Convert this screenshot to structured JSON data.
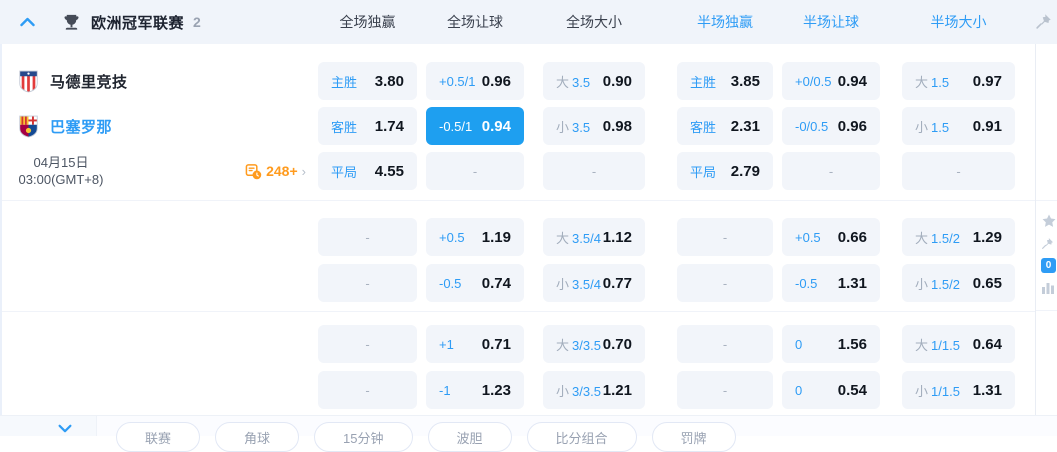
{
  "header": {
    "league": "欧洲冠军联赛",
    "count": "2",
    "columns": [
      "全场独赢",
      "全场让球",
      "全场大小",
      "半场独赢",
      "半场让球",
      "半场大小"
    ]
  },
  "match": {
    "home_team": "马德里竞技",
    "away_team": "巴塞罗那",
    "date": "04月15日",
    "time": "03:00(GMT+8)",
    "more_markets": "248+"
  },
  "odds": {
    "dash": "-",
    "groups": [
      {
        "rows": [
          {
            "cells": [
              {
                "label": "主胜",
                "value": "3.80"
              },
              {
                "label": "+0.5/1",
                "value": "0.96"
              },
              {
                "prefix": "大",
                "line": "3.5",
                "value": "0.90"
              },
              {
                "label": "主胜",
                "value": "3.85"
              },
              {
                "label": "+0/0.5",
                "value": "0.94"
              },
              {
                "prefix": "大",
                "line": "1.5",
                "value": "0.97"
              }
            ]
          },
          {
            "cells": [
              {
                "label": "客胜",
                "value": "1.74"
              },
              {
                "label": "-0.5/1",
                "value": "0.94",
                "selected": true
              },
              {
                "prefix": "小",
                "line": "3.5",
                "value": "0.98"
              },
              {
                "label": "客胜",
                "value": "2.31"
              },
              {
                "label": "-0/0.5",
                "value": "0.96"
              },
              {
                "prefix": "小",
                "line": "1.5",
                "value": "0.91"
              }
            ]
          },
          {
            "cells": [
              {
                "label": "平局",
                "value": "4.55"
              },
              {
                "dash": true
              },
              {
                "dash": true
              },
              {
                "label": "平局",
                "value": "2.79"
              },
              {
                "dash": true
              },
              {
                "dash": true
              }
            ]
          }
        ]
      },
      {
        "rows": [
          {
            "cells": [
              {
                "dash": true
              },
              {
                "label": "+0.5",
                "value": "1.19"
              },
              {
                "prefix": "大",
                "line": "3.5/4",
                "value": "1.12"
              },
              {
                "dash": true
              },
              {
                "label": "+0.5",
                "value": "0.66"
              },
              {
                "prefix": "大",
                "line": "1.5/2",
                "value": "1.29"
              }
            ]
          },
          {
            "cells": [
              {
                "dash": true
              },
              {
                "label": "-0.5",
                "value": "0.74"
              },
              {
                "prefix": "小",
                "line": "3.5/4",
                "value": "0.77"
              },
              {
                "dash": true
              },
              {
                "label": "-0.5",
                "value": "1.31"
              },
              {
                "prefix": "小",
                "line": "1.5/2",
                "value": "0.65"
              }
            ]
          }
        ]
      },
      {
        "rows": [
          {
            "cells": [
              {
                "dash": true
              },
              {
                "label": "+1",
                "value": "0.71"
              },
              {
                "prefix": "大",
                "line": "3/3.5",
                "value": "0.70"
              },
              {
                "dash": true
              },
              {
                "label": "0",
                "value": "1.56"
              },
              {
                "prefix": "大",
                "line": "1/1.5",
                "value": "0.64"
              }
            ]
          },
          {
            "cells": [
              {
                "dash": true
              },
              {
                "label": "-1",
                "value": "1.23"
              },
              {
                "prefix": "小",
                "line": "3/3.5",
                "value": "1.21"
              },
              {
                "dash": true
              },
              {
                "label": "0",
                "value": "0.54"
              },
              {
                "prefix": "小",
                "line": "1/1.5",
                "value": "1.31"
              }
            ]
          }
        ]
      }
    ]
  },
  "side": {
    "badge": "0"
  },
  "footer": {
    "pills": [
      "联赛",
      "角球",
      "15分钟",
      "波胆",
      "比分组合",
      "罚牌"
    ]
  },
  "colors": {
    "accent_blue": "#2e9cf5",
    "selected_blue": "#1e9ff0",
    "orange": "#ff9b1e"
  }
}
